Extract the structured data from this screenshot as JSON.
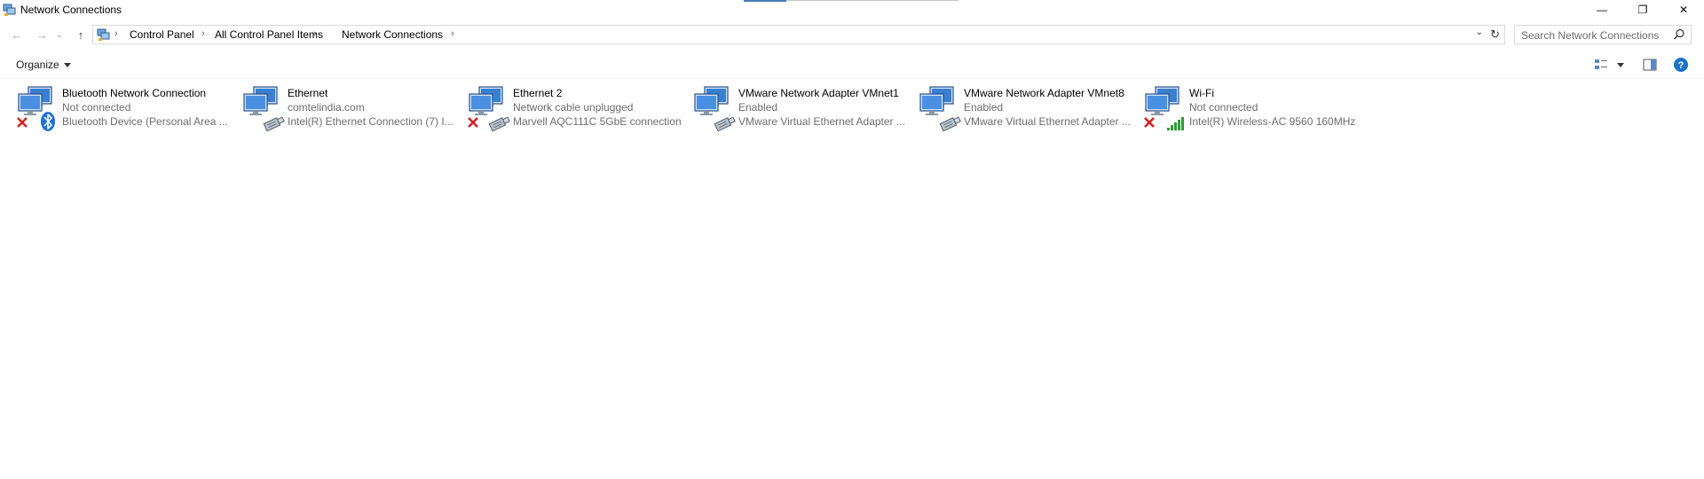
{
  "window": {
    "title": "Network Connections",
    "minimize_glyph": "—",
    "restore_glyph": "❐",
    "close_glyph": "✕"
  },
  "nav": {
    "back_glyph": "←",
    "forward_glyph": "→",
    "recent_glyph": "⌄",
    "up_glyph": "↑"
  },
  "breadcrumb": {
    "items": [
      "Control Panel",
      "All Control Panel Items",
      "Network Connections"
    ],
    "separator": "›"
  },
  "search": {
    "placeholder": "Search Network Connections"
  },
  "toolbar": {
    "organize_label": "Organize"
  },
  "connections": [
    {
      "name": "Bluetooth Network Connection",
      "status": "Not connected",
      "device": "Bluetooth Device (Personal Area ...",
      "badge": "bluetooth-icon",
      "disconnected": true
    },
    {
      "name": "Ethernet",
      "status": "comtelindia.com",
      "device": "Intel(R) Ethernet Connection (7) I...",
      "badge": "network-cable-icon",
      "disconnected": false
    },
    {
      "name": "Ethernet 2",
      "status": "Network cable unplugged",
      "device": "Marvell AQC111C 5GbE connection",
      "badge": "network-cable-icon",
      "disconnected": true
    },
    {
      "name": "VMware Network Adapter VMnet1",
      "status": "Enabled",
      "device": "VMware Virtual Ethernet Adapter ...",
      "badge": "network-cable-icon",
      "disconnected": false
    },
    {
      "name": "VMware Network Adapter VMnet8",
      "status": "Enabled",
      "device": "VMware Virtual Ethernet Adapter ...",
      "badge": "network-cable-icon",
      "disconnected": false
    },
    {
      "name": "Wi-Fi",
      "status": "Not connected",
      "device": "Intel(R) Wireless-AC 9560 160MHz",
      "badge": "wifi-signal-icon",
      "disconnected": true
    }
  ],
  "colors": {
    "monitor_blue": "#3a7fd0",
    "error_red": "#d32020",
    "bluetooth_blue": "#1e6fd8",
    "wifi_green": "#2e9b3a",
    "help_blue": "#1a73c8"
  }
}
